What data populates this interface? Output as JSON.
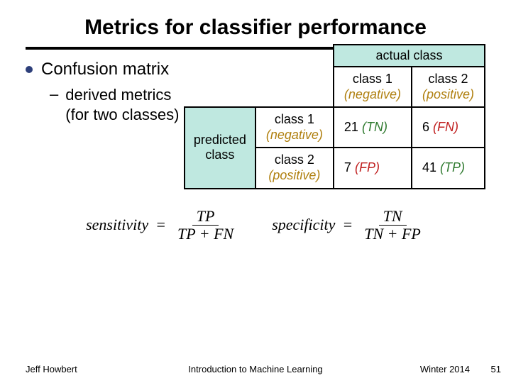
{
  "title": "Metrics for classifier performance",
  "bullet": "Confusion matrix",
  "sub_bullet_line1": "derived metrics",
  "sub_bullet_line2": "(for two classes)",
  "table": {
    "actual_header": "actual class",
    "predicted_header": "predicted class",
    "col1_name": "class 1",
    "col1_paren": "(negative)",
    "col2_name": "class 2",
    "col2_paren": "(positive)",
    "row1_name": "class 1",
    "row1_paren": "(negative)",
    "row2_name": "class 2",
    "row2_paren": "(positive)",
    "cell_tn_val": "21",
    "cell_tn_lab": "(TN)",
    "cell_fn_val": "6",
    "cell_fn_lab": "(FN)",
    "cell_fp_val": "7",
    "cell_fp_lab": "(FP)",
    "cell_tp_val": "41",
    "cell_tp_lab": "(TP)"
  },
  "formulas": {
    "sens_label": "sensitivity",
    "sens_num": "TP",
    "sens_den": "TP + FN",
    "spec_label": "specificity",
    "spec_num": "TN",
    "spec_den": "TN + FP",
    "eq": "="
  },
  "footer": {
    "left": "Jeff Howbert",
    "center": "Introduction to Machine Learning",
    "right": "Winter 2014",
    "page": "51"
  }
}
